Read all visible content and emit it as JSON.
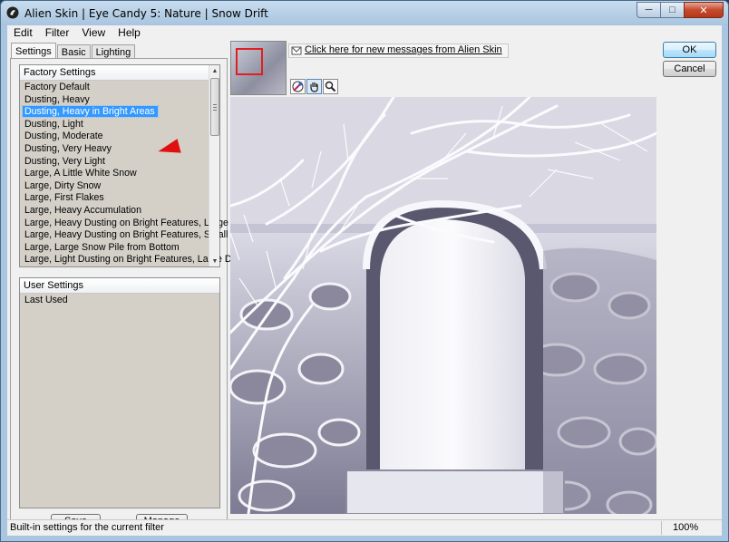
{
  "window": {
    "title": "Alien Skin | Eye Candy 5: Nature | Snow Drift",
    "minimize_glyph": "─",
    "maximize_glyph": "□",
    "close_glyph": "✕"
  },
  "menu": [
    "Edit",
    "Filter",
    "View",
    "Help"
  ],
  "tabs": [
    "Settings",
    "Basic",
    "Lighting"
  ],
  "factory_settings": {
    "header": "Factory Settings",
    "items": [
      "Factory Default",
      "Dusting, Heavy",
      "Dusting, Heavy in Bright Areas",
      "Dusting, Light",
      "Dusting, Moderate",
      "Dusting, Very Heavy",
      "Dusting, Very Light",
      "Large, A Little White Snow",
      "Large, Dirty Snow",
      "Large, First Flakes",
      "Large, Heavy Accumulation",
      "Large, Heavy Dusting on Bright Features, Large Drift",
      "Large, Heavy Dusting on Bright Features, Small Drift",
      "Large, Large Snow Pile from Bottom",
      "Large, Light Dusting on Bright Features, Large Drift"
    ],
    "selected": "Dusting, Heavy in Bright Areas"
  },
  "user_settings": {
    "header": "User Settings",
    "items": [
      "Last Used"
    ]
  },
  "buttons": {
    "save": "Save",
    "manage": "Manage",
    "ok": "OK",
    "cancel": "Cancel"
  },
  "message_link": "Click here for new messages from Alien Skin",
  "status": {
    "text": "Built-in settings for the current filter",
    "zoom": "100%"
  },
  "colors": {
    "selection": "#3399ff",
    "arrow": "#e01010",
    "titlebar": "#a9c6e1"
  }
}
